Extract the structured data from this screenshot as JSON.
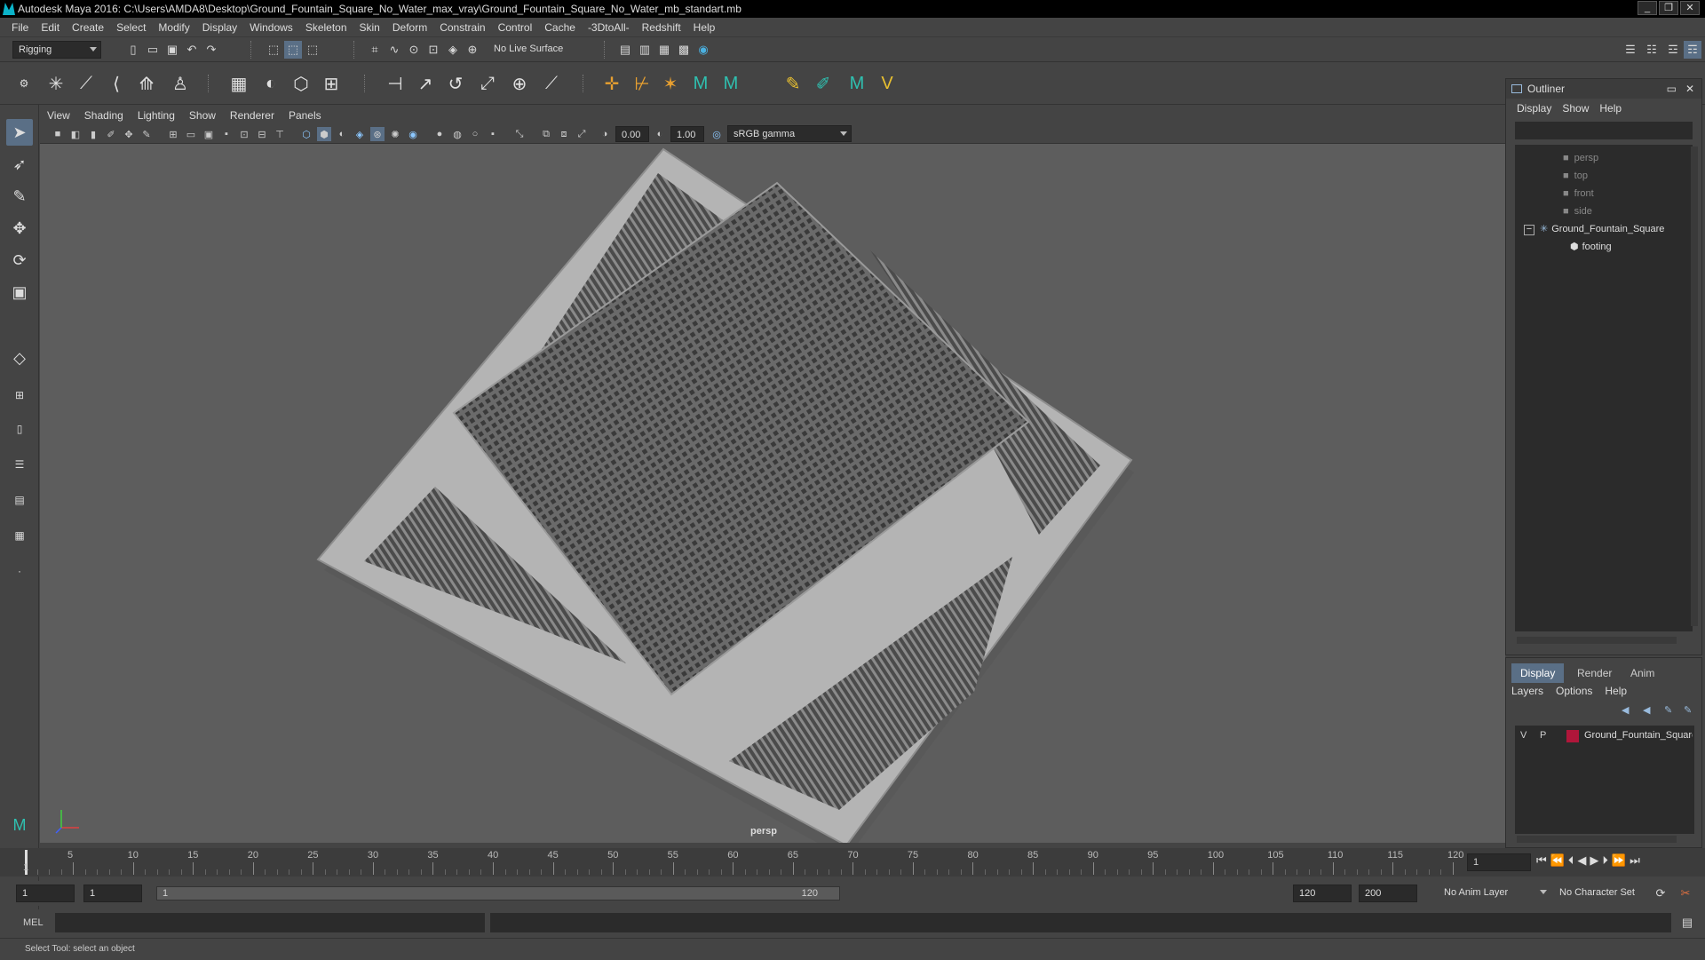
{
  "window": {
    "title": "Autodesk Maya 2016: C:\\Users\\AMDA8\\Desktop\\Ground_Fountain_Square_No_Water_max_vray\\Ground_Fountain_Square_No_Water_mb_standart.mb",
    "controls": [
      "_",
      "❐",
      "✕"
    ]
  },
  "menubar": [
    "File",
    "Edit",
    "Create",
    "Select",
    "Modify",
    "Display",
    "Windows",
    "Skeleton",
    "Skin",
    "Deform",
    "Constrain",
    "Control",
    "Cache",
    "-3DtoAll-",
    "Redshift",
    "Help"
  ],
  "statusline": {
    "menuset": "Rigging",
    "live_surface": "No Live Surface"
  },
  "panel": {
    "menus": [
      "View",
      "Shading",
      "Lighting",
      "Show",
      "Renderer",
      "Panels"
    ],
    "exposure": "0.00",
    "gamma": "1.00",
    "colorspace": "sRGB gamma",
    "camera_label": "persp"
  },
  "outliner": {
    "title": "Outliner",
    "menus": [
      "Display",
      "Show",
      "Help"
    ],
    "items": [
      {
        "label": "persp",
        "kind": "camera",
        "dim": true
      },
      {
        "label": "top",
        "kind": "camera",
        "dim": true
      },
      {
        "label": "front",
        "kind": "camera",
        "dim": true
      },
      {
        "label": "side",
        "kind": "camera",
        "dim": true
      },
      {
        "label": "Ground_Fountain_Square",
        "kind": "group",
        "dim": false
      },
      {
        "label": "footing",
        "kind": "mesh",
        "dim": false
      }
    ]
  },
  "layers": {
    "tabs": [
      "Display",
      "Render",
      "Anim"
    ],
    "active_tab": "Display",
    "menus": [
      "Layers",
      "Options",
      "Help"
    ],
    "rows": [
      {
        "v": "V",
        "p": "P",
        "name": "Ground_Fountain_Square",
        "color": "#b0163a"
      }
    ]
  },
  "timeline": {
    "ticks": [
      "5",
      "10",
      "15",
      "20",
      "25",
      "30",
      "35",
      "40",
      "45",
      "50",
      "55",
      "60",
      "65",
      "70",
      "75",
      "80",
      "85",
      "90",
      "95",
      "100",
      "105",
      "110",
      "115",
      "120"
    ],
    "start_label": "1",
    "current_frame": "1"
  },
  "range": {
    "start": "1",
    "playback_start": "1",
    "range_min": "1",
    "range_max": "120",
    "playback_end": "120",
    "end": "200",
    "anim_layer": "No Anim Layer",
    "character_set": "No Character Set"
  },
  "command": {
    "mode": "MEL"
  },
  "helpline": "Select Tool: select an object"
}
